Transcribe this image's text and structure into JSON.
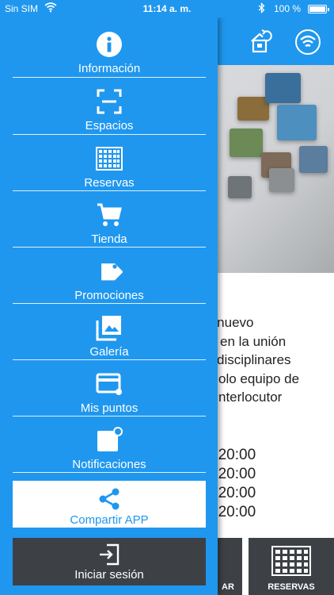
{
  "status_bar": {
    "carrier": "Sin SIM",
    "time": "11:14 a. m.",
    "battery": "100 %"
  },
  "background": {
    "text_lines": [
      "a nuevo",
      "en la unión",
      "disciplinares",
      "olo equipo de",
      "nterlocutor"
    ],
    "hours": [
      "- 20:00",
      "- 20:00",
      "- 20:00",
      "- 20:00"
    ],
    "bottom_buttons": {
      "left_label": "AR",
      "reservas_label": "RESERVAS"
    }
  },
  "drawer": {
    "items": [
      {
        "label": "Información",
        "icon": "info-icon"
      },
      {
        "label": "Espacios",
        "icon": "scan-frame-icon"
      },
      {
        "label": "Reservas",
        "icon": "calendar-grid-icon"
      },
      {
        "label": "Tienda",
        "icon": "shopping-cart-icon"
      },
      {
        "label": "Promociones",
        "icon": "tag-icon"
      },
      {
        "label": "Galería",
        "icon": "photo-library-icon"
      },
      {
        "label": "Mis puntos",
        "icon": "card-icon"
      },
      {
        "label": "Notificaciones",
        "icon": "notification-icon"
      }
    ],
    "share": {
      "label": "Compartir APP",
      "icon": "share-icon"
    },
    "login": {
      "label": "Iniciar sesión",
      "icon": "login-icon"
    }
  },
  "colors": {
    "primary": "#1f97ef",
    "dark": "#3d4145",
    "white": "#ffffff"
  }
}
